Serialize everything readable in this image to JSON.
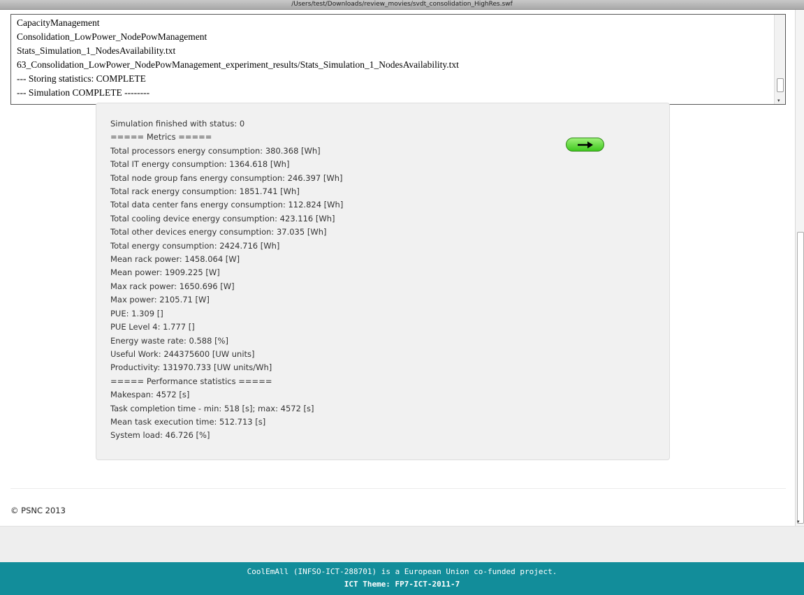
{
  "window": {
    "title": "/Users/test/Downloads/review_movies/svdt_consolidation_HighRes.swf"
  },
  "log": {
    "lines": [
      "CapacityManagement",
      "Consolidation_LowPower_NodePowManagement",
      "Stats_Simulation_1_NodesAvailability.txt",
      "63_Consolidation_LowPower_NodePowManagement_experiment_results/Stats_Simulation_1_NodesAvailability.txt",
      "--- Storing statistics: COMPLETE",
      "--- Simulation COMPLETE --------"
    ]
  },
  "results": {
    "lines": [
      "Simulation finished with status: 0",
      "===== Metrics =====",
      "Total processors energy consumption: 380.368 [Wh]",
      "Total IT energy consumption: 1364.618 [Wh]",
      "Total node group fans energy consumption: 246.397 [Wh]",
      "Total rack energy consumption: 1851.741 [Wh]",
      "Total data center fans energy consumption: 112.824 [Wh]",
      "Total cooling device energy consumption: 423.116 [Wh]",
      "Total other devices energy consumption: 37.035 [Wh]",
      "Total energy consumption: 2424.716 [Wh]",
      "Mean rack power: 1458.064 [W]",
      "Mean power: 1909.225 [W]",
      "Max rack power: 1650.696 [W]",
      "Max power: 2105.71 [W]",
      "PUE: 1.309 []",
      "PUE Level 4: 1.777 []",
      "Energy waste rate: 0.588 [%]",
      "Useful Work: 244375600 [UW units]",
      "Productivity: 131970.733 [UW units/Wh]",
      "===== Performance statistics =====",
      "Makespan: 4572 [s]",
      "Task completion time - min: 518 [s]; max: 4572 [s]",
      "Mean task execution time: 512.713 [s]",
      "System load: 46.726 [%]"
    ],
    "next_button_icon": "arrow-right-icon",
    "next_button_color": "#3fc81e"
  },
  "copyright": "© PSNC 2013",
  "footer": {
    "line1": "CoolEmAll (INFSO-ICT-288701) is a European Union co-funded project.",
    "line2": "ICT Theme: FP7-ICT-2011-7",
    "background_color": "#128d9a"
  }
}
